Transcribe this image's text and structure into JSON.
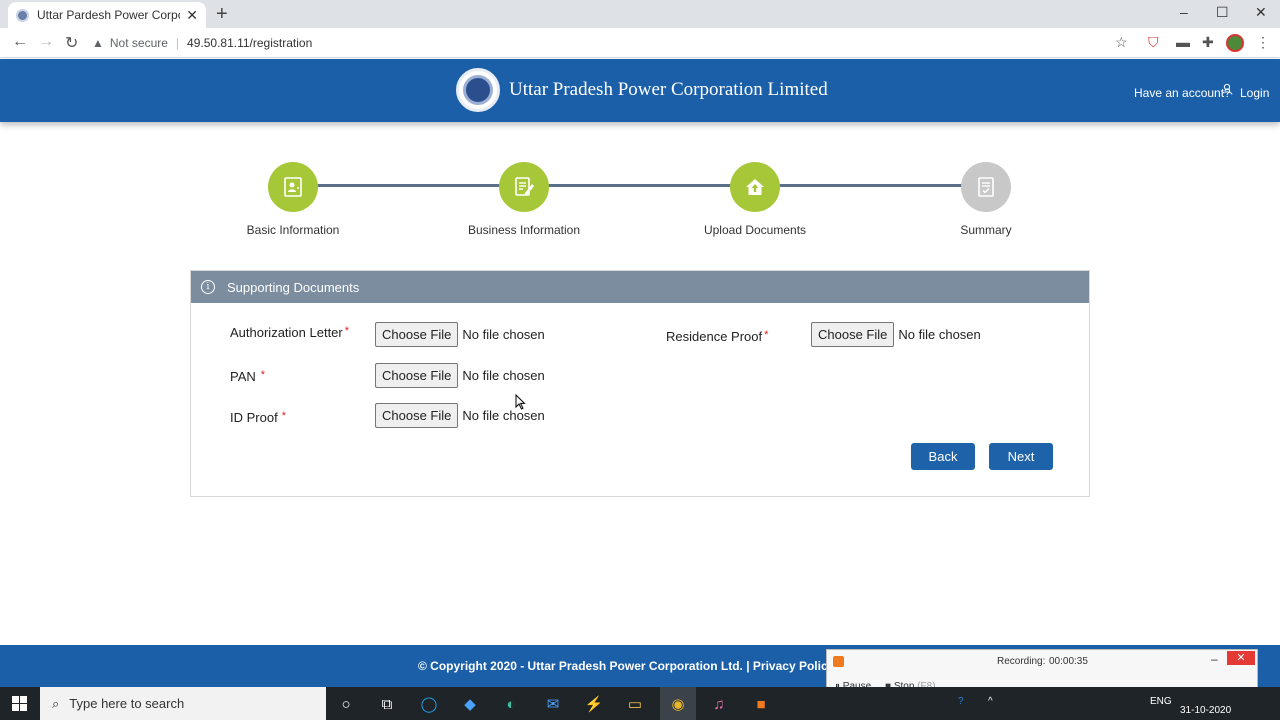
{
  "browser": {
    "tab_title": "Uttar Pardesh Power Corporation",
    "tab_close": "✕",
    "new_tab": "+",
    "security_label": "Not secure",
    "url": "49.50.81.11/registration"
  },
  "header": {
    "title": "Uttar Pradesh Power Corporation Limited",
    "account_prompt": "Have an account?",
    "login_label": "Login"
  },
  "steps": [
    {
      "label": "Basic Information",
      "state": "complete",
      "icon": "user-card-icon"
    },
    {
      "label": "Business Information",
      "state": "complete",
      "icon": "edit-document-icon"
    },
    {
      "label": "Upload Documents",
      "state": "active",
      "icon": "upload-home-icon"
    },
    {
      "label": "Summary",
      "state": "pending",
      "icon": "summary-doc-icon"
    }
  ],
  "panel": {
    "heading": "Supporting Documents",
    "fields": {
      "authorization": {
        "label": "Authorization Letter",
        "button": "Choose File",
        "status": "No file chosen"
      },
      "pan": {
        "label": "PAN",
        "button": "Choose File",
        "status": "No file chosen"
      },
      "id_proof": {
        "label": "ID Proof",
        "button": "Choose File",
        "status": "No file chosen"
      },
      "residence": {
        "label": "Residence Proof",
        "button": "Choose File",
        "status": "No file chosen"
      }
    },
    "required_mark": "*",
    "back_label": "Back",
    "next_label": "Next"
  },
  "footer": {
    "text": "© Copyright 2020 - Uttar Pradesh Power Corporation Ltd. | Privacy Policy | Disc"
  },
  "recorder": {
    "label": "Recording:",
    "time": "00:00:35",
    "pause_label": "Pause",
    "stop_label": "Stop",
    "stop_key": "(F8)"
  },
  "taskbar": {
    "search_placeholder": "Type here to search",
    "language": "ENG",
    "date": "31-10-2020"
  },
  "colors": {
    "header_blue": "#1b5fa8",
    "step_green": "#a6c838",
    "step_gray": "#c8c8c8",
    "panel_head": "#7b8d9f",
    "button_blue": "#1e63a9"
  }
}
